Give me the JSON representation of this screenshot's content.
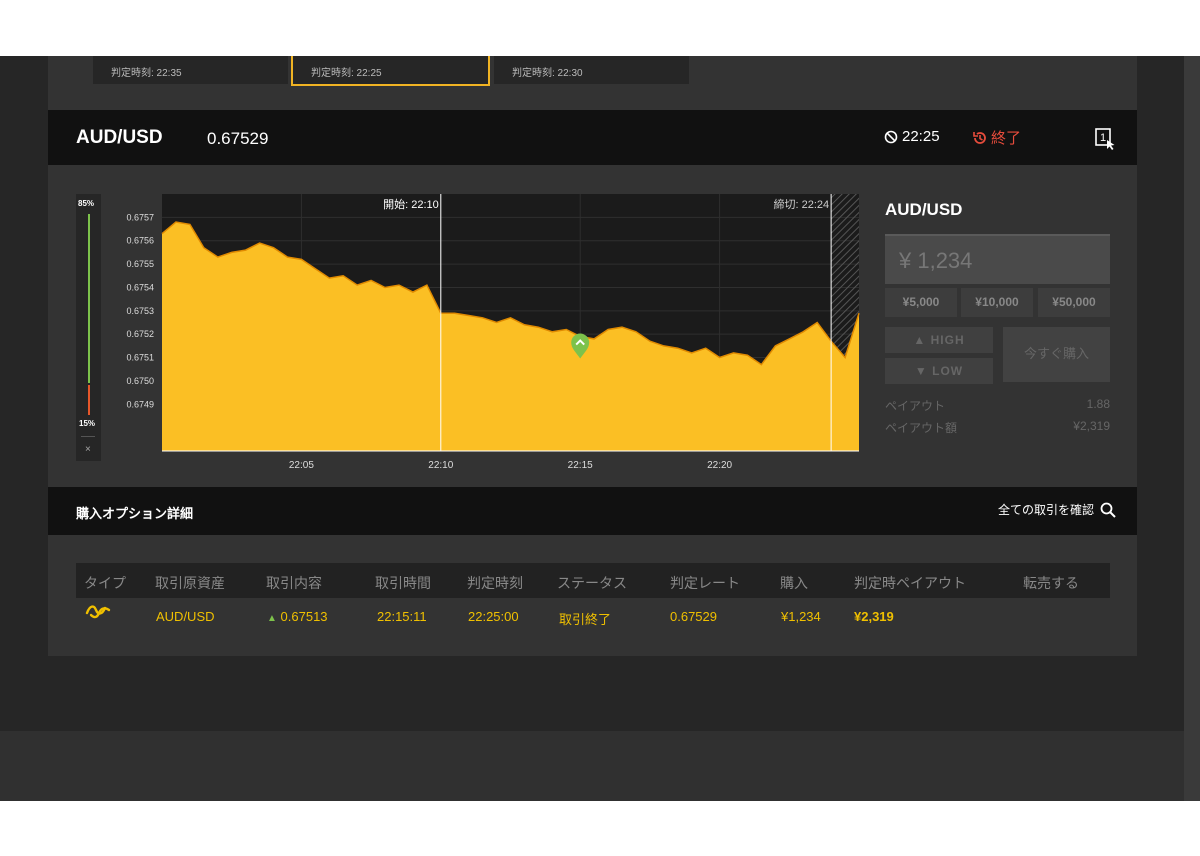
{
  "cards": [
    {
      "label": "判定時刻: 22:35"
    },
    {
      "label": "判定時刻: 22:25"
    },
    {
      "label": "判定時刻: 22:30"
    }
  ],
  "header": {
    "pair": "AUD/USD",
    "rate": "0.67529",
    "time": "22:25",
    "status": "終了",
    "slot_number": "1"
  },
  "gauge": {
    "high_pct": "85%",
    "low_pct": "15%",
    "close": "×"
  },
  "chart_data": {
    "type": "area",
    "y_ticks": [
      "0.6757",
      "0.6756",
      "0.6755",
      "0.6754",
      "0.6753",
      "0.6752",
      "0.6751",
      "0.6750",
      "0.6749"
    ],
    "x_ticks": [
      "22:05",
      "22:10",
      "22:15",
      "22:20"
    ],
    "start_label": "開始: 22:10",
    "cutoff_label": "締切: 22:24",
    "ylim": [
      0.6747,
      0.6758
    ],
    "series": [
      {
        "x": [
          "22:00",
          "22:00:30",
          "22:01",
          "22:01:30",
          "22:02",
          "22:02:30",
          "22:03",
          "22:03:30",
          "22:04",
          "22:04:30",
          "22:05",
          "22:05:30",
          "22:06",
          "22:06:30",
          "22:07",
          "22:07:30",
          "22:08",
          "22:08:30",
          "22:09",
          "22:09:30",
          "22:10",
          "22:10:30",
          "22:11",
          "22:11:30",
          "22:12",
          "22:12:30",
          "22:13",
          "22:13:30",
          "22:14",
          "22:14:30",
          "22:15",
          "22:15:30",
          "22:16",
          "22:16:30",
          "22:17",
          "22:17:30",
          "22:18",
          "22:18:30",
          "22:19",
          "22:19:30",
          "22:20",
          "22:20:30",
          "22:21",
          "22:21:30",
          "22:22",
          "22:22:30",
          "22:23",
          "22:23:30",
          "22:24",
          "22:24:30",
          "22:25"
        ],
        "values": [
          0.67563,
          0.67568,
          0.67567,
          0.67557,
          0.67553,
          0.67555,
          0.67556,
          0.67559,
          0.67557,
          0.67553,
          0.67552,
          0.67548,
          0.67544,
          0.67545,
          0.67541,
          0.67543,
          0.6754,
          0.67541,
          0.67538,
          0.67541,
          0.67529,
          0.67529,
          0.67528,
          0.67527,
          0.67525,
          0.67527,
          0.67524,
          0.67523,
          0.67521,
          0.67522,
          0.67519,
          0.67518,
          0.67522,
          0.67523,
          0.67521,
          0.67517,
          0.67515,
          0.67514,
          0.67512,
          0.67514,
          0.6751,
          0.67512,
          0.67511,
          0.67507,
          0.67515,
          0.67518,
          0.67521,
          0.67525,
          0.67517,
          0.6751,
          0.67529
        ]
      }
    ],
    "marker": {
      "x": "22:15",
      "value": 0.67513,
      "direction": "HIGH"
    }
  },
  "order": {
    "title": "AUD/USD",
    "amount_placeholder": "¥ 1,234",
    "presets": [
      "¥5,000",
      "¥10,000",
      "¥50,000"
    ],
    "high_label": "HIGH",
    "low_label": "LOW",
    "buy_label": "今すぐ購入",
    "payout_label": "ペイアウト",
    "payout_value": "1.88",
    "payout_amount_label": "ペイアウト額",
    "payout_amount_value": "¥2,319"
  },
  "details": {
    "title": "購入オプション詳細",
    "view_all": "全ての取引を確認",
    "headers": [
      "タイプ",
      "取引原資産",
      "取引内容",
      "取引時間",
      "判定時刻",
      "ステータス",
      "判定レート",
      "購入",
      "判定時ペイアウト",
      "転売する"
    ],
    "row": {
      "asset": "AUD/USD",
      "rate": "0.67513",
      "trade_time": "22:15:11",
      "expiry": "22:25:00",
      "status": "取引終了",
      "expiry_rate": "0.67529",
      "purchase": "¥1,234",
      "payout": "¥2,319"
    }
  },
  "colors": {
    "accent": "#f0b323",
    "area": "#fbbf24",
    "up": "#7dc24b",
    "down": "#e7572a",
    "status_ended": "#e74c3c"
  }
}
